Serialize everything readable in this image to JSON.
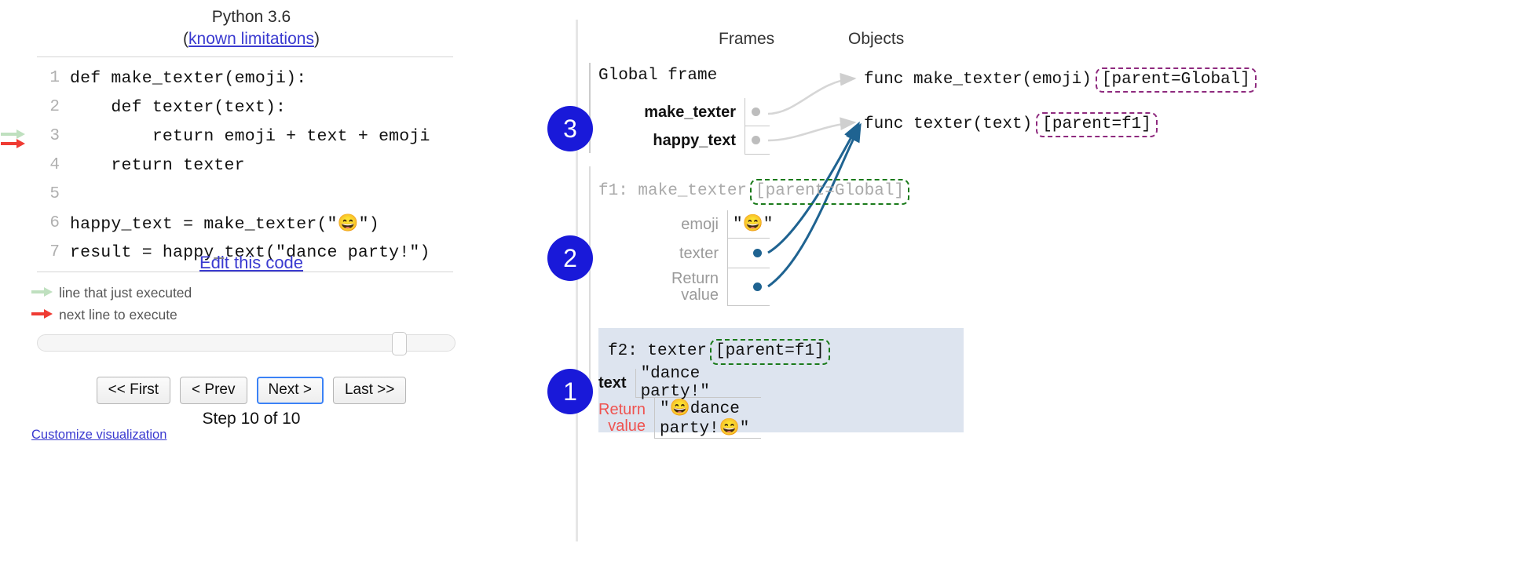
{
  "left": {
    "python_version": "Python 3.6",
    "limitations_prefix": "(",
    "limitations_link": "known limitations",
    "limitations_suffix": ")",
    "code_lines": [
      {
        "num": "1",
        "text": "def make_texter(emoji):",
        "arrow": "none"
      },
      {
        "num": "2",
        "text": "    def texter(text):",
        "arrow": "none"
      },
      {
        "num": "3",
        "text": "        return emoji + text + emoji",
        "arrow": "both"
      },
      {
        "num": "4",
        "text": "    return texter",
        "arrow": "none"
      },
      {
        "num": "5",
        "text": "",
        "arrow": "none"
      },
      {
        "num": "6",
        "text": "happy_text = make_texter(\"😄\")",
        "arrow": "none"
      },
      {
        "num": "7",
        "text": "result = happy_text(\"dance party!\")",
        "arrow": "none"
      }
    ],
    "edit_link": "Edit this code",
    "legend": [
      {
        "icon": "green-arrow-icon",
        "label": "line that just executed"
      },
      {
        "icon": "red-arrow-icon",
        "label": "next line to execute"
      }
    ],
    "buttons": [
      {
        "label": "<< First",
        "focused": false
      },
      {
        "label": "< Prev",
        "focused": false
      },
      {
        "label": "Next >",
        "focused": true
      },
      {
        "label": "Last >>",
        "focused": false
      }
    ],
    "step_label": "Step 10 of 10",
    "customize_link": "Customize visualization",
    "slider_value_pct": 88
  },
  "right": {
    "frames_header": "Frames",
    "objects_header": "Objects",
    "frames": [
      {
        "title": "Global frame",
        "parent_tag": null,
        "state": "active",
        "vars": [
          {
            "name": "make_texter",
            "value": "",
            "kind": "pointer",
            "name_style": "bold"
          },
          {
            "name": "happy_text",
            "value": "",
            "kind": "pointer",
            "name_style": "bold"
          }
        ]
      },
      {
        "title": "f1: make_texter",
        "parent_tag": "[parent=Global]",
        "state": "inactive",
        "vars": [
          {
            "name": "emoji",
            "value": "\"😄\"",
            "kind": "value",
            "name_style": "muted"
          },
          {
            "name": "texter",
            "value": "",
            "kind": "pointer-blue",
            "name_style": "muted"
          },
          {
            "name": "Return value",
            "value": "",
            "kind": "pointer-blue",
            "name_style": "muted"
          }
        ]
      },
      {
        "title": "f2: texter",
        "parent_tag": "[parent=f1]",
        "state": "active-highlight",
        "vars": [
          {
            "name": "text",
            "value": "\"dance party!\"",
            "kind": "value",
            "name_style": "bold"
          },
          {
            "name": "Return value",
            "value": "\"😄dance party!😄\"",
            "kind": "value",
            "name_style": "retred"
          }
        ]
      }
    ],
    "objects": [
      {
        "label": "func make_texter(emoji)",
        "parent_tag": "[parent=Global]"
      },
      {
        "label": "func texter(text)",
        "parent_tag": "[parent=f1]"
      }
    ],
    "annotations": [
      {
        "number": "1"
      },
      {
        "number": "2"
      },
      {
        "number": "3"
      }
    ]
  },
  "colors": {
    "annotation_blue": "#1919d9",
    "green_dashed": "#1a7a1a",
    "purple_dashed": "#8e2a7e",
    "pointer_blue": "#1f6391",
    "return_red": "#ef5350",
    "link_blue": "#3a3ad0",
    "frame_highlight": "#dde4ef"
  }
}
